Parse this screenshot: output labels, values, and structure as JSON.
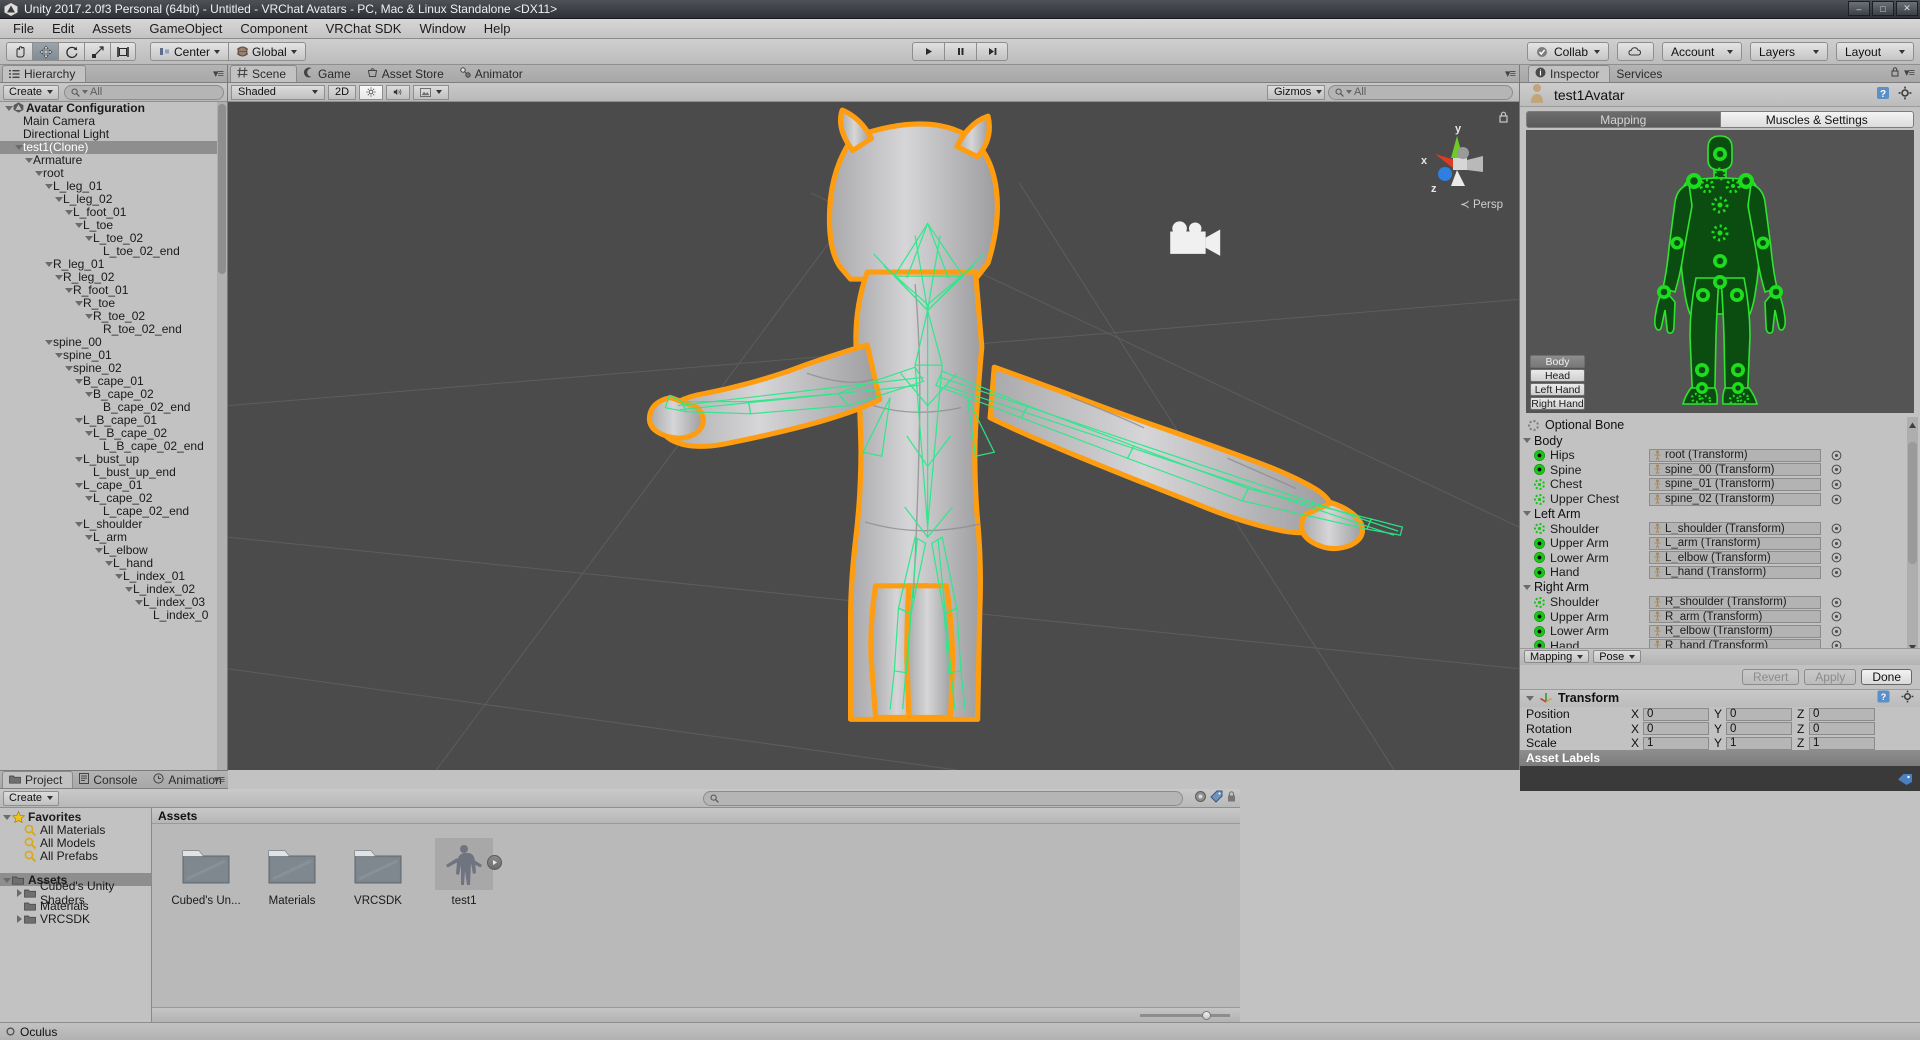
{
  "window": {
    "title": "Unity 2017.2.0f3 Personal (64bit) - Untitled - VRChat Avatars - PC, Mac & Linux Standalone <DX11>",
    "minimize": "–",
    "maximize": "□",
    "close": "✕"
  },
  "menu": [
    "File",
    "Edit",
    "Assets",
    "GameObject",
    "Component",
    "VRChat SDK",
    "Window",
    "Help"
  ],
  "toolbar": {
    "tools": [
      "hand-tool",
      "move-tool",
      "rotate-tool",
      "scale-tool",
      "rect-tool"
    ],
    "active_tool_index": 1,
    "pivot_label": "Center",
    "space_label": "Global",
    "play": "▶",
    "pause": "❚❚",
    "step": "▶❚",
    "collab": "Collab",
    "cloud": "cloud",
    "account": "Account",
    "layers": "Layers",
    "layout": "Layout"
  },
  "hierarchy": {
    "tab": "Hierarchy",
    "create": "Create",
    "search_placeholder": "All",
    "items": [
      {
        "label": "Avatar Configuration",
        "indent": 0,
        "arrow": "open",
        "bold": true,
        "icon": "unity-icon",
        "selected": false
      },
      {
        "label": "Main Camera",
        "indent": 1,
        "arrow": "none",
        "selected": false
      },
      {
        "label": "Directional Light",
        "indent": 1,
        "arrow": "none",
        "selected": false
      },
      {
        "label": "test1(Clone)",
        "indent": 1,
        "arrow": "open",
        "selected": true
      },
      {
        "label": "Armature",
        "indent": 2,
        "arrow": "open",
        "selected": false
      },
      {
        "label": "root",
        "indent": 3,
        "arrow": "open",
        "selected": false
      },
      {
        "label": "L_leg_01",
        "indent": 4,
        "arrow": "open",
        "selected": false
      },
      {
        "label": "L_leg_02",
        "indent": 5,
        "arrow": "open",
        "selected": false
      },
      {
        "label": "L_foot_01",
        "indent": 6,
        "arrow": "open",
        "selected": false
      },
      {
        "label": "L_toe",
        "indent": 7,
        "arrow": "open",
        "selected": false
      },
      {
        "label": "L_toe_02",
        "indent": 8,
        "arrow": "open",
        "selected": false
      },
      {
        "label": "L_toe_02_end",
        "indent": 9,
        "arrow": "none",
        "selected": false
      },
      {
        "label": "R_leg_01",
        "indent": 4,
        "arrow": "open",
        "selected": false
      },
      {
        "label": "R_leg_02",
        "indent": 5,
        "arrow": "open",
        "selected": false
      },
      {
        "label": "R_foot_01",
        "indent": 6,
        "arrow": "open",
        "selected": false
      },
      {
        "label": "R_toe",
        "indent": 7,
        "arrow": "open",
        "selected": false
      },
      {
        "label": "R_toe_02",
        "indent": 8,
        "arrow": "open",
        "selected": false
      },
      {
        "label": "R_toe_02_end",
        "indent": 9,
        "arrow": "none",
        "selected": false
      },
      {
        "label": "spine_00",
        "indent": 4,
        "arrow": "open",
        "selected": false
      },
      {
        "label": "spine_01",
        "indent": 5,
        "arrow": "open",
        "selected": false
      },
      {
        "label": "spine_02",
        "indent": 6,
        "arrow": "open",
        "selected": false
      },
      {
        "label": "B_cape_01",
        "indent": 7,
        "arrow": "open",
        "selected": false
      },
      {
        "label": "B_cape_02",
        "indent": 8,
        "arrow": "open",
        "selected": false
      },
      {
        "label": "B_cape_02_end",
        "indent": 9,
        "arrow": "none",
        "selected": false
      },
      {
        "label": "L_B_cape_01",
        "indent": 7,
        "arrow": "open",
        "selected": false
      },
      {
        "label": "L_B_cape_02",
        "indent": 8,
        "arrow": "open",
        "selected": false
      },
      {
        "label": "L_B_cape_02_end",
        "indent": 9,
        "arrow": "none",
        "selected": false
      },
      {
        "label": "L_bust_up",
        "indent": 7,
        "arrow": "open",
        "selected": false
      },
      {
        "label": "L_bust_up_end",
        "indent": 8,
        "arrow": "none",
        "selected": false
      },
      {
        "label": "L_cape_01",
        "indent": 7,
        "arrow": "open",
        "selected": false
      },
      {
        "label": "L_cape_02",
        "indent": 8,
        "arrow": "open",
        "selected": false
      },
      {
        "label": "L_cape_02_end",
        "indent": 9,
        "arrow": "none",
        "selected": false
      },
      {
        "label": "L_shoulder",
        "indent": 7,
        "arrow": "open",
        "selected": false
      },
      {
        "label": "L_arm",
        "indent": 8,
        "arrow": "open",
        "selected": false
      },
      {
        "label": "L_elbow",
        "indent": 9,
        "arrow": "open",
        "selected": false
      },
      {
        "label": "L_hand",
        "indent": 10,
        "arrow": "open",
        "selected": false
      },
      {
        "label": "L_index_01",
        "indent": 11,
        "arrow": "open",
        "selected": false
      },
      {
        "label": "L_index_02",
        "indent": 12,
        "arrow": "open",
        "selected": false
      },
      {
        "label": "L_index_03",
        "indent": 13,
        "arrow": "open",
        "selected": false
      },
      {
        "label": "L_index_0",
        "indent": 14,
        "arrow": "none",
        "selected": false
      }
    ]
  },
  "scene": {
    "tabs": [
      {
        "label": "Scene",
        "icon": "grid-icon",
        "selected": true
      },
      {
        "label": "Game",
        "icon": "gamepad-icon",
        "selected": false
      },
      {
        "label": "Asset Store",
        "icon": "cart-icon",
        "selected": false
      },
      {
        "label": "Animator",
        "icon": "animator-icon",
        "selected": false
      }
    ],
    "shading_mode": "Shaded",
    "two_d": "2D",
    "lighting_icon": "sun-icon",
    "audio_icon": "speaker-icon",
    "effects_icon": "image-icon",
    "gizmos": "Gizmos",
    "gizmo_search_placeholder": "All",
    "persp_label": "Persp",
    "axis_x": "x",
    "axis_y": "y",
    "axis_z": "z"
  },
  "project": {
    "tabs": [
      {
        "label": "Project",
        "icon": "folder-icon",
        "selected": true
      },
      {
        "label": "Console",
        "icon": "console-icon",
        "selected": false
      },
      {
        "label": "Animation",
        "icon": "clock-icon",
        "selected": false
      }
    ],
    "create": "Create",
    "search_placeholder": "",
    "tree": [
      {
        "label": "Favorites",
        "indent": 0,
        "arrow": "open",
        "icon": "star-icon",
        "bold": true,
        "selected": false
      },
      {
        "label": "All Materials",
        "indent": 1,
        "arrow": "none",
        "icon": "search-icon",
        "selected": false
      },
      {
        "label": "All Models",
        "indent": 1,
        "arrow": "none",
        "icon": "search-icon",
        "selected": false
      },
      {
        "label": "All Prefabs",
        "indent": 1,
        "arrow": "none",
        "icon": "search-icon",
        "selected": false
      },
      {
        "label": "",
        "indent": 0,
        "arrow": "none",
        "icon": "none",
        "spacer": true,
        "selected": false
      },
      {
        "label": "Assets",
        "indent": 0,
        "arrow": "open",
        "icon": "folder-icon",
        "bold": true,
        "selected": true
      },
      {
        "label": "Cubed's Unity Shaders",
        "indent": 1,
        "arrow": "closed",
        "icon": "folder-icon",
        "selected": false
      },
      {
        "label": "Materials",
        "indent": 1,
        "arrow": "none",
        "icon": "folder-icon",
        "selected": false
      },
      {
        "label": "VRCSDK",
        "indent": 1,
        "arrow": "closed",
        "icon": "folder-icon",
        "selected": false
      }
    ],
    "assets_header": "Assets",
    "assets": [
      {
        "label": "Cubed's Un...",
        "type": "folder",
        "selected": false
      },
      {
        "label": "Materials",
        "type": "folder",
        "selected": false
      },
      {
        "label": "VRCSDK",
        "type": "folder",
        "selected": false
      },
      {
        "label": "test1",
        "type": "model",
        "selected": true
      }
    ]
  },
  "inspector": {
    "tabs": [
      {
        "label": "Inspector",
        "icon": "info-icon",
        "selected": true
      },
      {
        "label": "Services",
        "icon": "none",
        "selected": false
      }
    ],
    "object_name": "test1Avatar",
    "help_icon": "help-icon",
    "gear_icon": "gear-icon",
    "lock_icon": "lock-icon",
    "seg_tabs": [
      {
        "label": "Mapping",
        "selected": false
      },
      {
        "label": "Muscles & Settings",
        "selected": true
      }
    ],
    "avatar_buttons": [
      {
        "label": "Body",
        "selected": true
      },
      {
        "label": "Head",
        "selected": false
      },
      {
        "label": "Left Hand",
        "selected": false
      },
      {
        "label": "Right Hand",
        "selected": false
      }
    ],
    "optional_bone": "Optional Bone",
    "bone_groups": [
      {
        "name": "Body",
        "bones": [
          {
            "label": "Hips",
            "value": "root (Transform)",
            "state": "solid"
          },
          {
            "label": "Spine",
            "value": "spine_00 (Transform)",
            "state": "solid"
          },
          {
            "label": "Chest",
            "value": "spine_01 (Transform)",
            "state": "dotted"
          },
          {
            "label": "Upper Chest",
            "value": "spine_02 (Transform)",
            "state": "dotted"
          }
        ]
      },
      {
        "name": "Left Arm",
        "bones": [
          {
            "label": "Shoulder",
            "value": "L_shoulder (Transform)",
            "state": "dotted"
          },
          {
            "label": "Upper Arm",
            "value": "L_arm (Transform)",
            "state": "solid"
          },
          {
            "label": "Lower Arm",
            "value": "L_elbow (Transform)",
            "state": "solid"
          },
          {
            "label": "Hand",
            "value": "L_hand (Transform)",
            "state": "solid"
          }
        ]
      },
      {
        "name": "Right Arm",
        "bones": [
          {
            "label": "Shoulder",
            "value": "R_shoulder (Transform)",
            "state": "dotted"
          },
          {
            "label": "Upper Arm",
            "value": "R_arm (Transform)",
            "state": "solid"
          },
          {
            "label": "Lower Arm",
            "value": "R_elbow (Transform)",
            "state": "solid"
          },
          {
            "label": "Hand",
            "value": "R_hand (Transform)",
            "state": "solid"
          }
        ]
      }
    ],
    "mapping_menu": "Mapping",
    "pose_menu": "Pose",
    "revert": "Revert",
    "apply": "Apply",
    "done": "Done",
    "transform": {
      "title": "Transform",
      "rows": [
        {
          "name": "Position",
          "x": "0",
          "y": "0",
          "z": "0"
        },
        {
          "name": "Rotation",
          "x": "0",
          "y": "0",
          "z": "0"
        },
        {
          "name": "Scale",
          "x": "1",
          "y": "1",
          "z": "1"
        }
      ],
      "axis_x": "X",
      "axis_y": "Y",
      "axis_z": "Z"
    },
    "asset_labels": "Asset Labels"
  },
  "status": {
    "text": "Oculus",
    "icon": "dot-icon"
  },
  "colors": {
    "selection_outline": "#ff9d10",
    "bone_green": "#2ce88a",
    "avatar_green": "#18c718",
    "panel_bg": "#c2c2c2",
    "scene_bg": "#4b4b4b"
  }
}
